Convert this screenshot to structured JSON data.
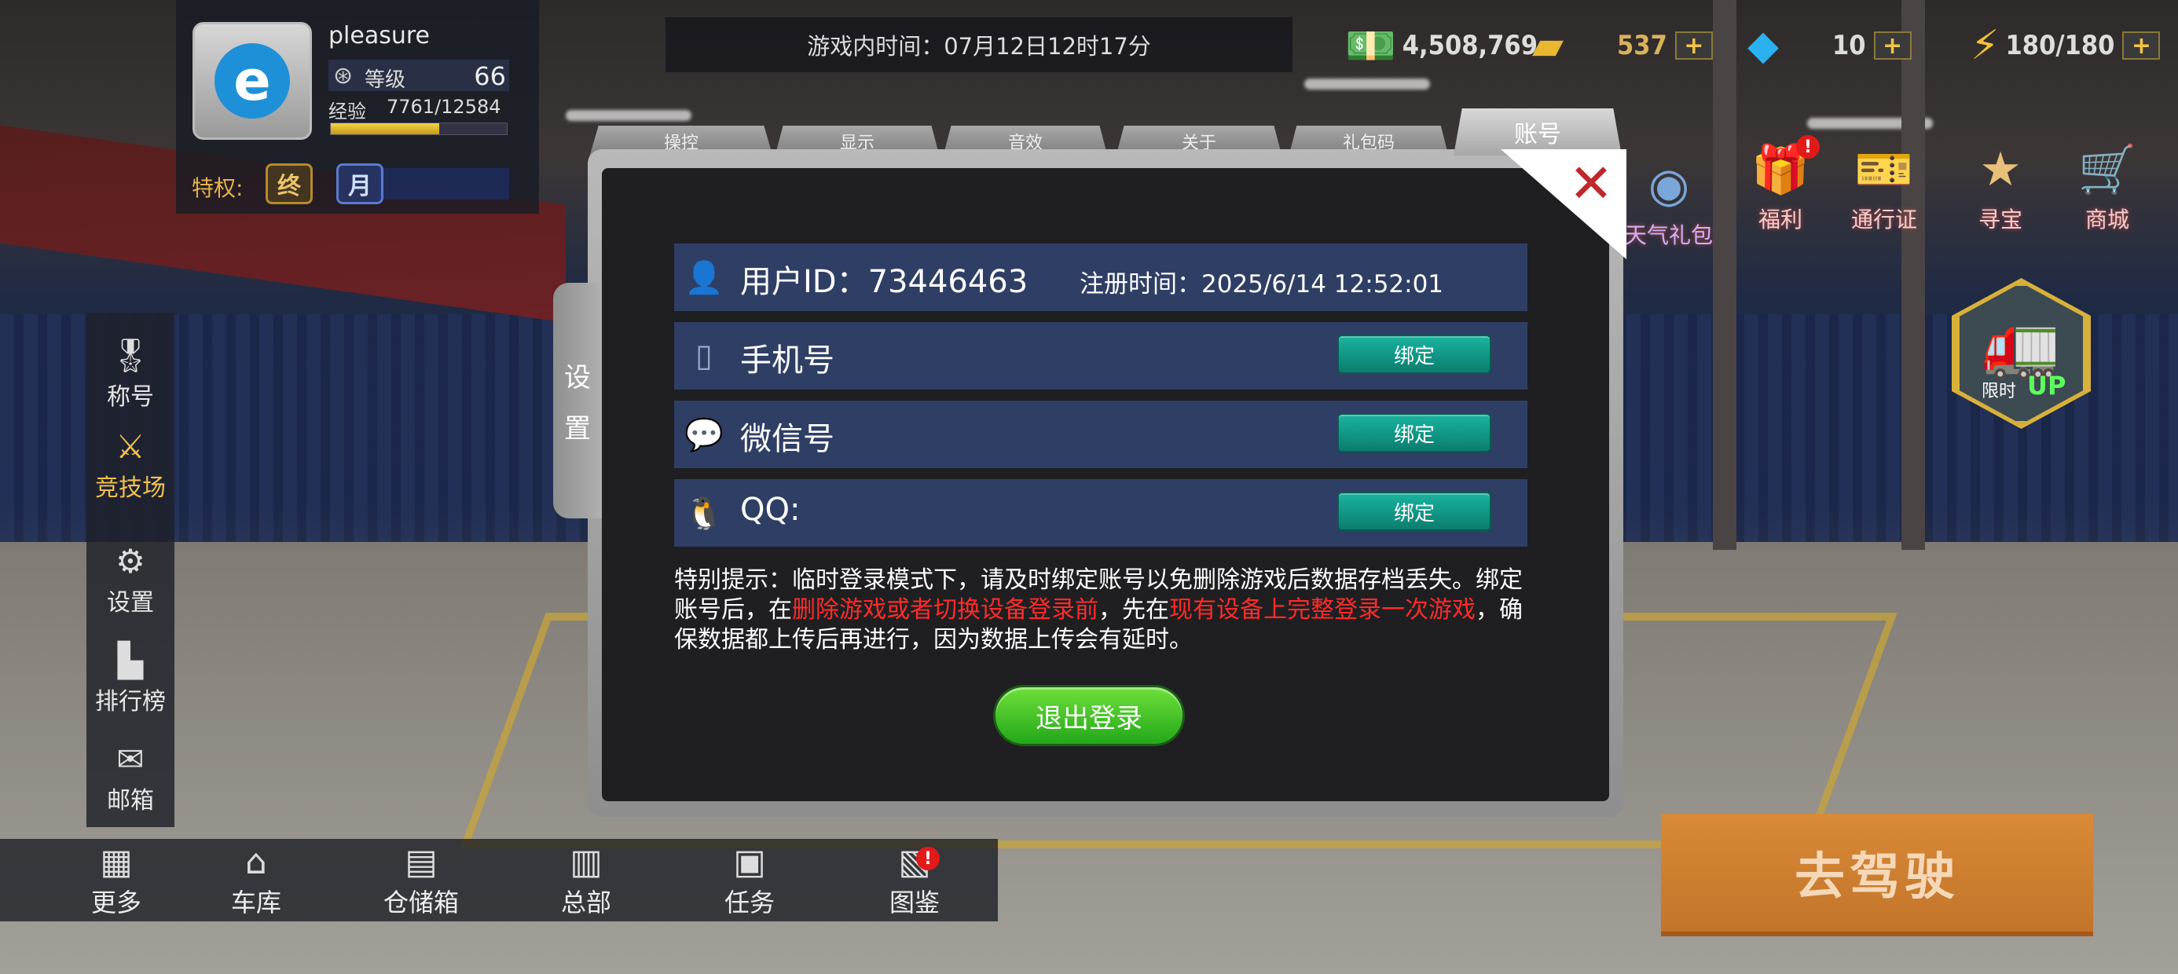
{
  "profile": {
    "username": "pleasure",
    "level_label": "等级",
    "level_value": "66",
    "exp_label": "经验",
    "exp_value": "7761/12584",
    "exp_fraction": 0.617,
    "privilege_label": "特权:",
    "badges": [
      "终",
      "月"
    ]
  },
  "topbar": {
    "game_time": "游戏内时间：07月12日12时17分",
    "money": "4,508,769",
    "gold": "537",
    "diamond": "10",
    "energy": "180/180",
    "plus": "+"
  },
  "left_menu": {
    "title_label": "称号",
    "arena_label": "竞技场",
    "settings_label": "设置",
    "ranking_label": "排行榜",
    "mail_label": "邮箱"
  },
  "bottom_bar": {
    "more": "更多",
    "garage": "车库",
    "storage": "仓储箱",
    "hq": "总部",
    "tasks": "任务",
    "catalog": "图鉴",
    "badge": "!"
  },
  "right_panel": {
    "weather_gift": "天气礼包",
    "welfare": "福利",
    "pass": "通行证",
    "treasure": "寻宝",
    "shop": "商城",
    "welfare_badge": "!",
    "limited": "限时",
    "up": "UP",
    "go_drive": "去驾驶"
  },
  "dialog": {
    "side_tab": [
      "设",
      "置"
    ],
    "tabs": [
      "操控",
      "显示",
      "音效",
      "关于",
      "礼包码",
      "账号"
    ],
    "close": "✕",
    "user_id": "用户ID：73446463",
    "register_time": "注册时间：2025/6/14 12:52:01",
    "phone_label": "手机号",
    "wechat_label": "微信号",
    "qq_label": "QQ:",
    "bind_label": "绑定",
    "tip_part1": "特别提示：临时登录模式下，请及时绑定账号以免删除游戏后数据存档丢失。绑定账号后，在",
    "tip_red1": "删除游戏或者切换设备登录前",
    "tip_part2": "，先在",
    "tip_red2": "现有设备上完整登录一次游戏",
    "tip_part3": "，确保数据都上传后再进行，因为数据上传会有延时。",
    "logout": "退出登录"
  },
  "colors": {
    "row_bg": "#2f3e64",
    "bind_btn": "#0b7d6e",
    "logout_btn": "#23a81a",
    "warning_red": "#ff2b2b",
    "go_drive": "#d98a37"
  }
}
